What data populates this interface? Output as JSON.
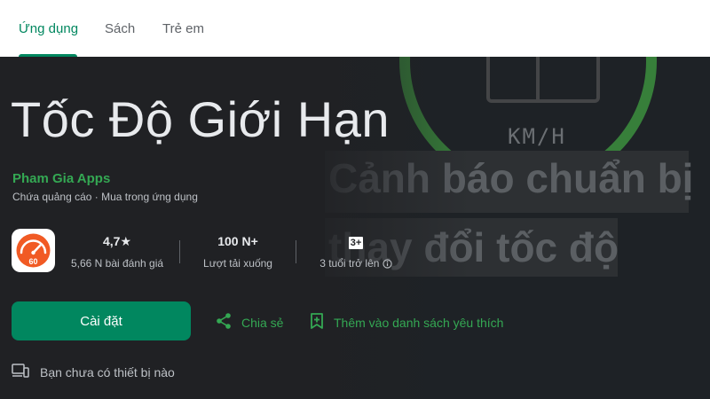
{
  "tabs": [
    {
      "label": "Ứng dụng"
    },
    {
      "label": "Sách"
    },
    {
      "label": "Trẻ em"
    }
  ],
  "app": {
    "title": "Tốc Độ Giới Hạn",
    "developer": "Pham Gia Apps",
    "meta": "Chứa quảng cáo · Mua trong ứng dụng",
    "icon_number": "60"
  },
  "stats": {
    "rating": "4,7★",
    "reviews": "5,66 N bài đánh giá",
    "downloads": "100 N+",
    "downloads_label": "Lượt tải xuống",
    "age_badge": "3+",
    "age_label": "3 tuổi trở lên"
  },
  "actions": {
    "install": "Cài đặt",
    "share": "Chia sẻ",
    "wishlist": "Thêm vào danh sách yêu thích"
  },
  "device_note": "Bạn chưa có thiết bị nào",
  "promo": {
    "unit": "KM/H",
    "line1": "Cảnh báo chuẩn bị",
    "line2": "thay đổi tốc độ"
  },
  "colors": {
    "accent": "#01875f",
    "link": "#34a853",
    "background": "#202124",
    "icon_orange": "#f15a24"
  }
}
